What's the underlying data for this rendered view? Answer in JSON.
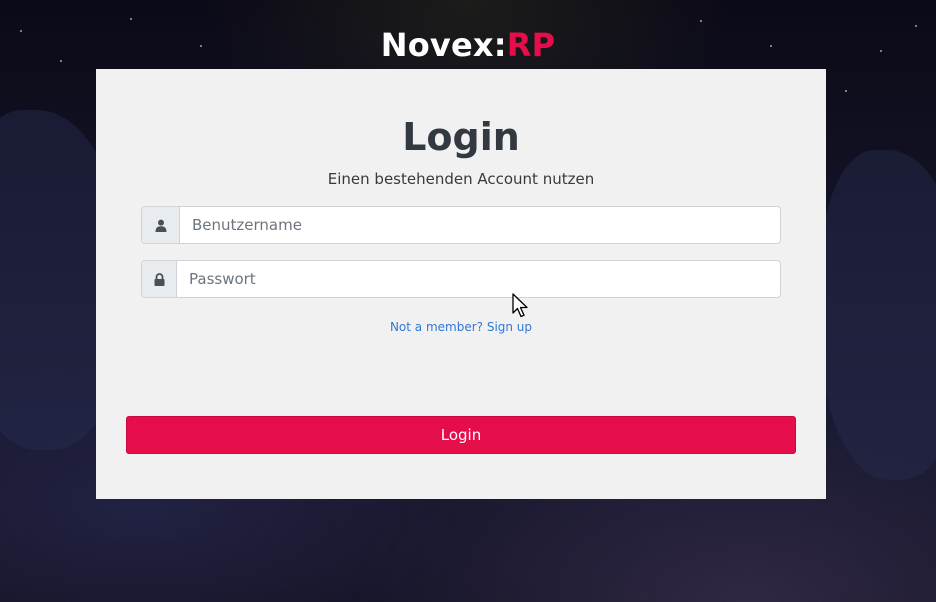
{
  "brand": {
    "name": "Novex:",
    "accent": "RP",
    "accent_color": "#e60d4b"
  },
  "card": {
    "title": "Login",
    "subtitle": "Einen bestehenden Account nutzen"
  },
  "form": {
    "username": {
      "placeholder": "Benutzername",
      "value": "",
      "icon": "user-icon"
    },
    "password": {
      "placeholder": "Passwort",
      "value": "",
      "icon": "lock-icon"
    },
    "signup_link": "Not a member? Sign up",
    "submit_label": "Login",
    "submit_color": "#e60d4b",
    "link_color": "#2f78d8"
  }
}
